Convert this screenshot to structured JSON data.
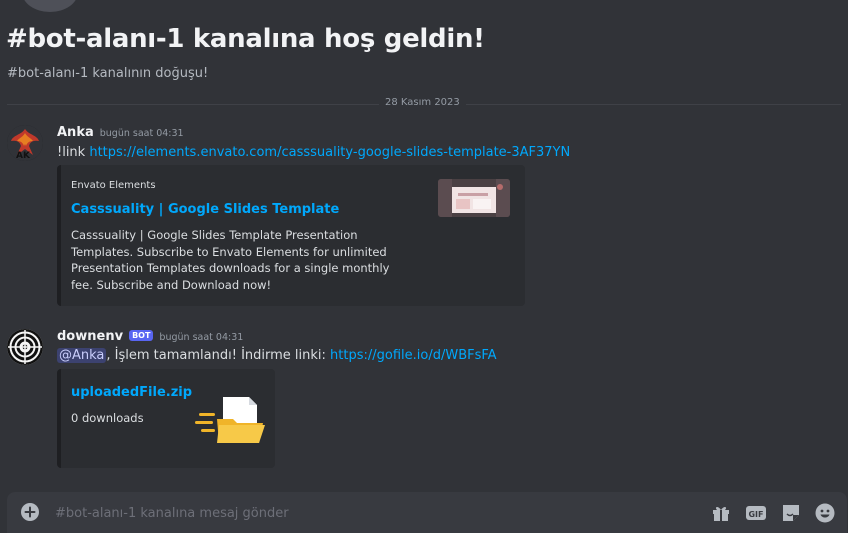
{
  "channel": {
    "welcome_title": "#bot-alanı-1 kanalına hoş geldin!",
    "welcome_subtitle": "#bot-alanı-1 kanalının doğuşu!"
  },
  "date_divider": "28 Kasım 2023",
  "messages": [
    {
      "author": "Anka",
      "timestamp": "bugün saat 04:31",
      "avatar_icon": "phoenix-avatar-icon",
      "content_prefix": "!link ",
      "content_link": "https://elements.envato.com/casssuality-google-slides-template-3AF37YN",
      "embed": {
        "provider": "Envato Elements",
        "title": "Casssuality | Google Slides Template",
        "description": "Casssuality | Google Slides Template Presentation Templates. Subscribe to Envato Elements for unlimited Presentation Templates downloads for a single monthly fee. Subscribe and Download now!",
        "thumbnail_icon": "slides-template-thumbnail"
      }
    },
    {
      "author": "downenv",
      "bot_tag": "BOT",
      "timestamp": "bugün saat 04:31",
      "avatar_icon": "spiral-avatar-icon",
      "mention": "@Anka",
      "content_text": ", İşlem tamamlandı! İndirme linki: ",
      "content_link": "https://gofile.io/d/WBFsFA",
      "attachment": {
        "name": "uploadedFile.zip",
        "downloads": "0 downloads",
        "icon": "zip-folder-icon"
      }
    }
  ],
  "composer": {
    "placeholder": "#bot-alanı-1 kanalına mesaj gönder",
    "gif_label": "GIF",
    "icons": [
      "add-circle-icon",
      "gift-icon",
      "gif-icon",
      "sticker-icon",
      "emoji-icon"
    ]
  },
  "colors": {
    "background": "#313338",
    "link": "#00a8fc",
    "bot_tag": "#5865f2",
    "embed_background": "#2b2d31",
    "composer_background": "#383a40"
  }
}
